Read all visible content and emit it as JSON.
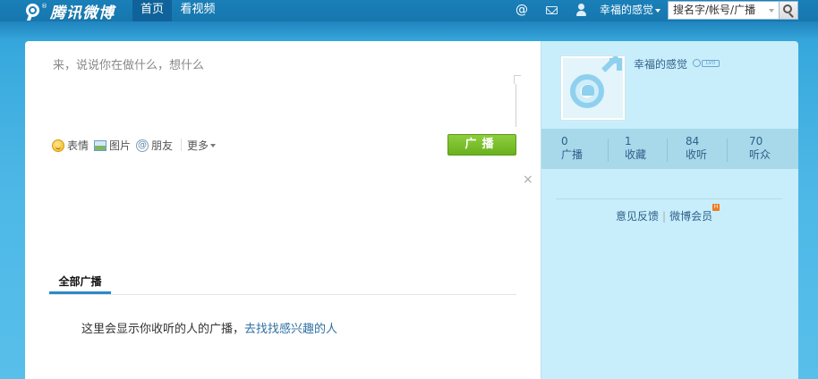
{
  "topbar": {
    "logo_text": "腾讯微博",
    "logo_reg": "®",
    "nav": [
      {
        "label": "首页",
        "active": true
      },
      {
        "label": "看视频",
        "active": false
      }
    ],
    "at_symbol": "@",
    "icons": [
      "at-icon",
      "mail-icon",
      "user-icon"
    ],
    "username": "幸福的感觉",
    "search_placeholder": "搜名字/帐号/广播"
  },
  "composer": {
    "placeholder": "来，说说你在做什么，想什么",
    "tools": [
      {
        "label": "表情",
        "icon": "emoji-icon"
      },
      {
        "label": "图片",
        "icon": "picture-icon"
      },
      {
        "label": "朋友",
        "icon": "mention-icon"
      }
    ],
    "more_label": "更多",
    "broadcast_label": "广播",
    "close_glyph": "×",
    "mention_glyph": "@"
  },
  "feed": {
    "tab_label": "全部广播",
    "empty_text": "这里会显示你收听的人的广播，",
    "empty_link": "去找找感兴趣的人"
  },
  "sidebar": {
    "name": "幸福的感觉",
    "vip_level": "LV0",
    "stats": [
      {
        "num": "0",
        "label": "广播"
      },
      {
        "num": "1",
        "label": "收藏"
      },
      {
        "num": "84",
        "label": "收听"
      },
      {
        "num": "70",
        "label": "听众"
      }
    ],
    "link_feedback": "意见反馈",
    "link_vip": "微博会员",
    "badge": "H"
  },
  "colors": {
    "accent": "#2c8ac8",
    "button_green": "#69b11e",
    "sidebar_bg": "#c8eefb",
    "topbar": "#1677ae"
  }
}
